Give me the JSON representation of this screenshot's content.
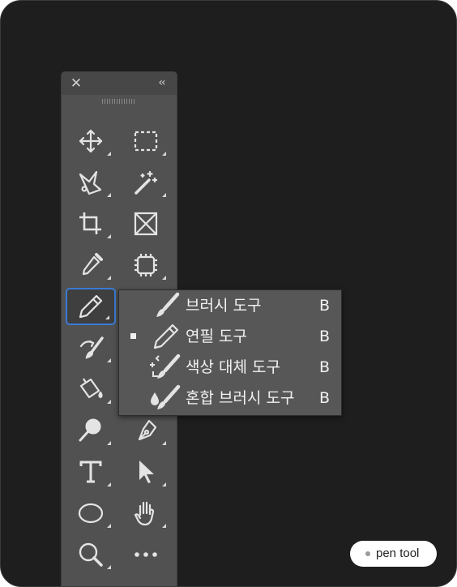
{
  "toolbar": {
    "close_icon": "close-icon",
    "collapse_icon": "collapse-chevrons-icon",
    "tools": [
      {
        "id": "move",
        "icon": "move-icon"
      },
      {
        "id": "rectangular-marquee",
        "icon": "marquee-icon"
      },
      {
        "id": "lasso",
        "icon": "polygonal-lasso-icon"
      },
      {
        "id": "magic-wand",
        "icon": "magic-wand-icon"
      },
      {
        "id": "crop",
        "icon": "crop-icon"
      },
      {
        "id": "frame",
        "icon": "frame-icon"
      },
      {
        "id": "eyedropper",
        "icon": "eyedropper-icon"
      },
      {
        "id": "spot-healing",
        "icon": "healing-icon"
      },
      {
        "id": "pencil",
        "icon": "pencil-icon",
        "active": true
      },
      {
        "id": "history-brush",
        "icon": "history-brush-icon"
      },
      {
        "id": "paint-bucket",
        "icon": "paint-bucket-icon"
      },
      {
        "id": "smudge",
        "icon": "smudge-icon"
      },
      {
        "id": "dodge",
        "icon": "dodge-icon"
      },
      {
        "id": "pen",
        "icon": "pen-icon"
      },
      {
        "id": "type",
        "icon": "type-icon"
      },
      {
        "id": "path-selection",
        "icon": "arrow-icon"
      },
      {
        "id": "ellipse",
        "icon": "ellipse-icon"
      },
      {
        "id": "hand",
        "icon": "hand-icon"
      },
      {
        "id": "zoom",
        "icon": "zoom-icon"
      },
      {
        "id": "more",
        "icon": "more-icon"
      }
    ]
  },
  "flyout": {
    "items": [
      {
        "label": "브러시 도구",
        "shortcut": "B",
        "icon": "brush-icon",
        "selected": false
      },
      {
        "label": "연필 도구",
        "shortcut": "B",
        "icon": "pencil-icon",
        "selected": true
      },
      {
        "label": "색상 대체 도구",
        "shortcut": "B",
        "icon": "color-replacement-icon",
        "selected": false
      },
      {
        "label": "혼합 브러시 도구",
        "shortcut": "B",
        "icon": "mixer-brush-icon",
        "selected": false
      }
    ]
  },
  "tooltip": {
    "text": "pen tool"
  },
  "colors": {
    "background": "#1e1e1e",
    "panel": "#515151",
    "active_border": "#3a7bd5",
    "icon": "#e4e4e4"
  }
}
